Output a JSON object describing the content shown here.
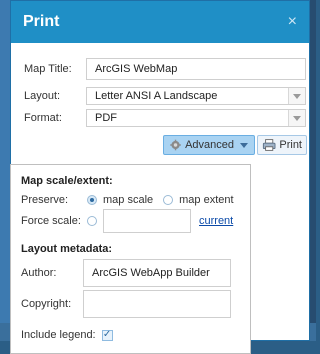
{
  "dialog": {
    "title": "Print",
    "close_glyph": "×"
  },
  "form": {
    "map_title_label": "Map Title:",
    "map_title_value": "ArcGIS WebMap",
    "layout_label": "Layout:",
    "layout_value": "Letter ANSI A Landscape",
    "format_label": "Format:",
    "format_value": "PDF"
  },
  "buttons": {
    "advanced_label": "Advanced",
    "print_label": "Print"
  },
  "advanced": {
    "scale_extent_heading": "Map scale/extent:",
    "preserve_label": "Preserve:",
    "map_scale_option": "map scale",
    "map_extent_option": "map extent",
    "selected_preserve": "map scale",
    "force_scale_label": "Force scale:",
    "force_scale_value": "",
    "current_link": "current",
    "layout_metadata_heading": "Layout metadata:",
    "author_label": "Author:",
    "author_value": "ArcGIS WebApp Builder",
    "copyright_label": "Copyright:",
    "copyright_value": "",
    "include_legend_label": "Include legend:",
    "include_legend_checked": true
  },
  "colors": {
    "titlebar": "#1f8fc6",
    "accent": "#2d6aa0",
    "background": "#2b5e86"
  }
}
